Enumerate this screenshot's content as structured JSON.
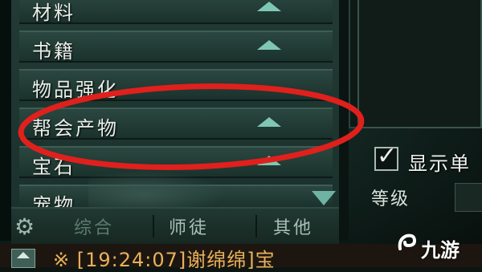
{
  "categories": [
    {
      "label": "材料"
    },
    {
      "label": "书籍"
    },
    {
      "label": "物品强化"
    },
    {
      "label": "帮会产物"
    },
    {
      "label": "宝石"
    },
    {
      "label": "宠物"
    }
  ],
  "options": {
    "show_label": "显示单",
    "level_label": "等级"
  },
  "tabs": [
    {
      "label": "综合"
    },
    {
      "label": "师徒"
    },
    {
      "label": "其他"
    }
  ],
  "chat": {
    "text": "※ [19:24:07]谢绵绵]宝"
  },
  "watermark": {
    "text": "九游"
  },
  "colors": {
    "highlight_circle": "#e0201c",
    "chat_text": "#e8b15a",
    "triangle": "#7fc7b4"
  }
}
